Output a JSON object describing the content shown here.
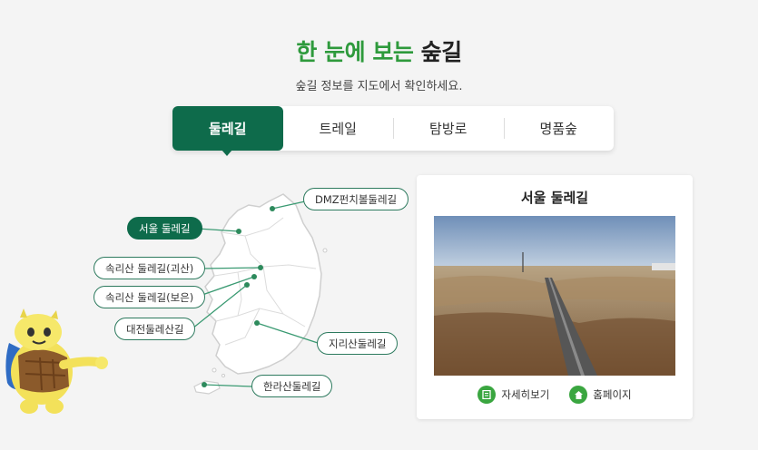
{
  "header": {
    "title_accent": "한 눈에 보는",
    "title_rest": "숲길",
    "subtitle": "숲길 정보를 지도에서 확인하세요."
  },
  "tabs": [
    {
      "label": "둘레길",
      "active": true
    },
    {
      "label": "트레일",
      "active": false
    },
    {
      "label": "탐방로",
      "active": false
    },
    {
      "label": "명품숲",
      "active": false
    }
  ],
  "map": {
    "trails": [
      {
        "label": "DMZ펀치볼둘레길",
        "active": false
      },
      {
        "label": "서울 둘레길",
        "active": true
      },
      {
        "label": "속리산 둘레길(괴산)",
        "active": false
      },
      {
        "label": "속리산 둘레길(보은)",
        "active": false
      },
      {
        "label": "대전둘레산길",
        "active": false
      },
      {
        "label": "지리산둘레길",
        "active": false
      },
      {
        "label": "한라산둘레길",
        "active": false
      }
    ]
  },
  "detail": {
    "title": "서울 둘레길",
    "detail_link": "자세히보기",
    "homepage_link": "홈페이지",
    "detail_icon": "document-icon",
    "homepage_icon": "home-icon"
  },
  "colors": {
    "accent_green": "#2e9a3c",
    "dark_green": "#0e6b4b",
    "icon_green": "#3aa640"
  }
}
